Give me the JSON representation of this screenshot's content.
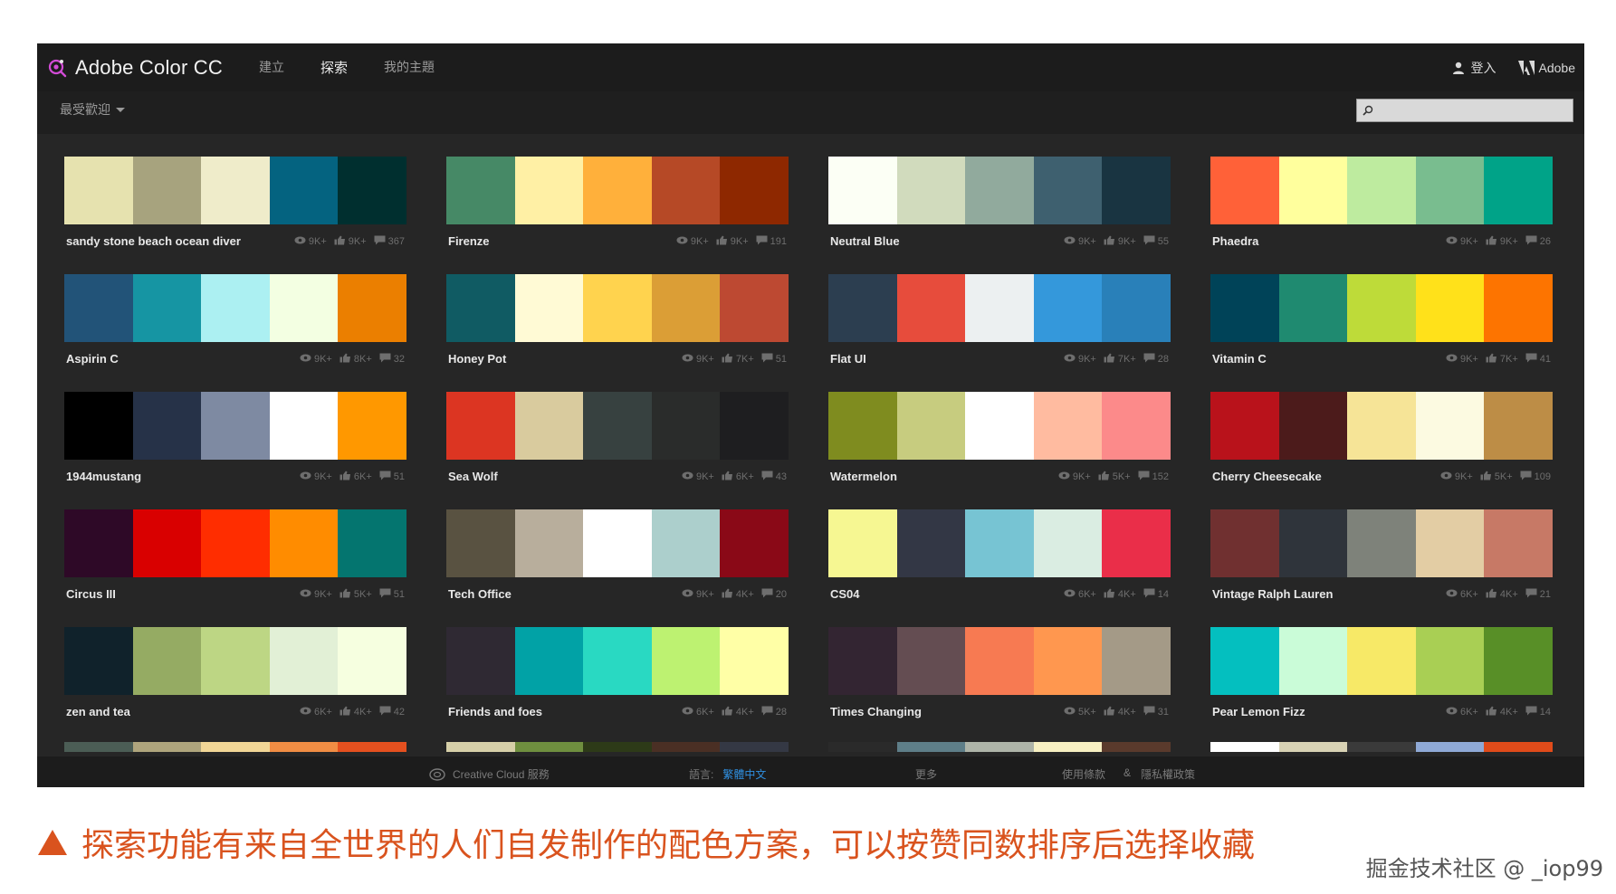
{
  "app": {
    "brand": "Adobe Color CC",
    "nav": [
      {
        "label": "建立",
        "active": false
      },
      {
        "label": "探索",
        "active": true
      },
      {
        "label": "我的主題",
        "active": false
      }
    ],
    "login_label": "登入",
    "adobe_label": "Adobe"
  },
  "subbar": {
    "sort_label": "最受歡迎",
    "search_placeholder": ""
  },
  "themes": [
    {
      "title": "sandy stone beach ocean diver",
      "views": "9K+",
      "likes": "9K+",
      "comments": "367",
      "colors": [
        "#E6E2AF",
        "#A7A37E",
        "#EFECCA",
        "#046380",
        "#002F2F"
      ]
    },
    {
      "title": "Firenze",
      "views": "9K+",
      "likes": "9K+",
      "comments": "191",
      "colors": [
        "#468966",
        "#FFF0A5",
        "#FFB03B",
        "#B64926",
        "#8E2800"
      ]
    },
    {
      "title": "Neutral Blue",
      "views": "9K+",
      "likes": "9K+",
      "comments": "55",
      "colors": [
        "#FCFFF5",
        "#D1DBBD",
        "#91AA9D",
        "#3E606F",
        "#193441"
      ]
    },
    {
      "title": "Phaedra",
      "views": "9K+",
      "likes": "9K+",
      "comments": "26",
      "colors": [
        "#FF6138",
        "#FFFF9D",
        "#BEEB9F",
        "#79BD8F",
        "#00A388"
      ]
    },
    {
      "title": "Aspirin C",
      "views": "9K+",
      "likes": "8K+",
      "comments": "32",
      "colors": [
        "#225378",
        "#1695A3",
        "#ACF0F2",
        "#F3FFE2",
        "#EB7F00"
      ]
    },
    {
      "title": "Honey Pot",
      "views": "9K+",
      "likes": "7K+",
      "comments": "51",
      "colors": [
        "#105B63",
        "#FFFAD5",
        "#FFD34E",
        "#DB9E36",
        "#BD4932"
      ]
    },
    {
      "title": "Flat UI",
      "views": "9K+",
      "likes": "7K+",
      "comments": "28",
      "colors": [
        "#2C3E50",
        "#E74C3C",
        "#ECF0F1",
        "#3498DB",
        "#2980B9"
      ]
    },
    {
      "title": "Vitamin C",
      "views": "9K+",
      "likes": "7K+",
      "comments": "41",
      "colors": [
        "#004358",
        "#1F8A70",
        "#BEDB39",
        "#FFE11A",
        "#FD7400"
      ]
    },
    {
      "title": "1944mustang",
      "views": "9K+",
      "likes": "6K+",
      "comments": "51",
      "colors": [
        "#000000",
        "#263248",
        "#7E8AA2",
        "#FFFFFF",
        "#FF9800"
      ]
    },
    {
      "title": "Sea Wolf",
      "views": "9K+",
      "likes": "6K+",
      "comments": "43",
      "colors": [
        "#DC3522",
        "#D9CB9E",
        "#374140",
        "#2A2C2B",
        "#1E1E20"
      ]
    },
    {
      "title": "Watermelon",
      "views": "9K+",
      "likes": "5K+",
      "comments": "152",
      "colors": [
        "#7F8C1F",
        "#C7CC7F",
        "#FFFFFF",
        "#FFBBA0",
        "#FC8A8A"
      ]
    },
    {
      "title": "Cherry Cheesecake",
      "views": "9K+",
      "likes": "5K+",
      "comments": "109",
      "colors": [
        "#B9121B",
        "#4C1B1B",
        "#F6E497",
        "#FCFAE1",
        "#BD8D46"
      ]
    },
    {
      "title": "Circus III",
      "views": "9K+",
      "likes": "5K+",
      "comments": "51",
      "colors": [
        "#2E0927",
        "#D90000",
        "#FF2D00",
        "#FF8C00",
        "#04756F"
      ]
    },
    {
      "title": "Tech Office",
      "views": "9K+",
      "likes": "4K+",
      "comments": "20",
      "colors": [
        "#595241",
        "#B8AE9C",
        "#FFFFFF",
        "#ACCFCC",
        "#8A0917"
      ]
    },
    {
      "title": "CS04",
      "views": "6K+",
      "likes": "4K+",
      "comments": "14",
      "colors": [
        "#F6F792",
        "#333745",
        "#77C4D3",
        "#DAEDE2",
        "#EA2E49"
      ]
    },
    {
      "title": "Vintage Ralph Lauren",
      "views": "6K+",
      "likes": "4K+",
      "comments": "21",
      "colors": [
        "#703030",
        "#2F343B",
        "#7E827A",
        "#E3CDA4",
        "#C77966"
      ]
    },
    {
      "title": "zen and tea",
      "views": "6K+",
      "likes": "4K+",
      "comments": "42",
      "colors": [
        "#10222B",
        "#95AB63",
        "#BDD684",
        "#E2F0D6",
        "#F6FFE0"
      ]
    },
    {
      "title": "Friends and foes",
      "views": "6K+",
      "likes": "4K+",
      "comments": "28",
      "colors": [
        "#2F2933",
        "#01A2A6",
        "#29D9C2",
        "#BDF271",
        "#FFFFA6"
      ]
    },
    {
      "title": "Times Changing",
      "views": "5K+",
      "likes": "4K+",
      "comments": "31",
      "colors": [
        "#332532",
        "#644D52",
        "#F77A52",
        "#FF974F",
        "#A49A87"
      ]
    },
    {
      "title": "Pear Lemon Fizz",
      "views": "6K+",
      "likes": "4K+",
      "comments": "14",
      "colors": [
        "#04BFBF",
        "#CAFCD8",
        "#F7E967",
        "#A9CF54",
        "#588F27"
      ]
    }
  ],
  "peek_row": [
    {
      "colors": [
        "#4B5D55",
        "#AFA57D",
        "#F1D696",
        "#F08D44",
        "#E5501F"
      ]
    },
    {
      "colors": [
        "#D6CFA8",
        "#6F8F3F",
        "#2D3A18",
        "#4A2F24",
        "#343844"
      ]
    },
    {
      "colors": [
        "#2A2A2A",
        "#5E7E88",
        "#AEB4A8",
        "#F7F0C2",
        "#5A3A2C"
      ]
    },
    {
      "colors": [
        "#FFFFFF",
        "#D8D2B4",
        "#3A3A3A",
        "#8FA9D6",
        "#E04B1A"
      ]
    }
  ],
  "footer": {
    "cc_label": "Creative Cloud 服務",
    "lang_label": "語言:",
    "lang_value": "繁體中文",
    "more_label": "更多",
    "terms_label": "使用條款",
    "amp": "&",
    "privacy_label": "隱私權政策"
  },
  "caption": "探索功能有来自全世界的人们自发制作的配色方案，可以按赞同数排序后选择收藏",
  "watermark": "掘金技术社区 @ _iop99"
}
